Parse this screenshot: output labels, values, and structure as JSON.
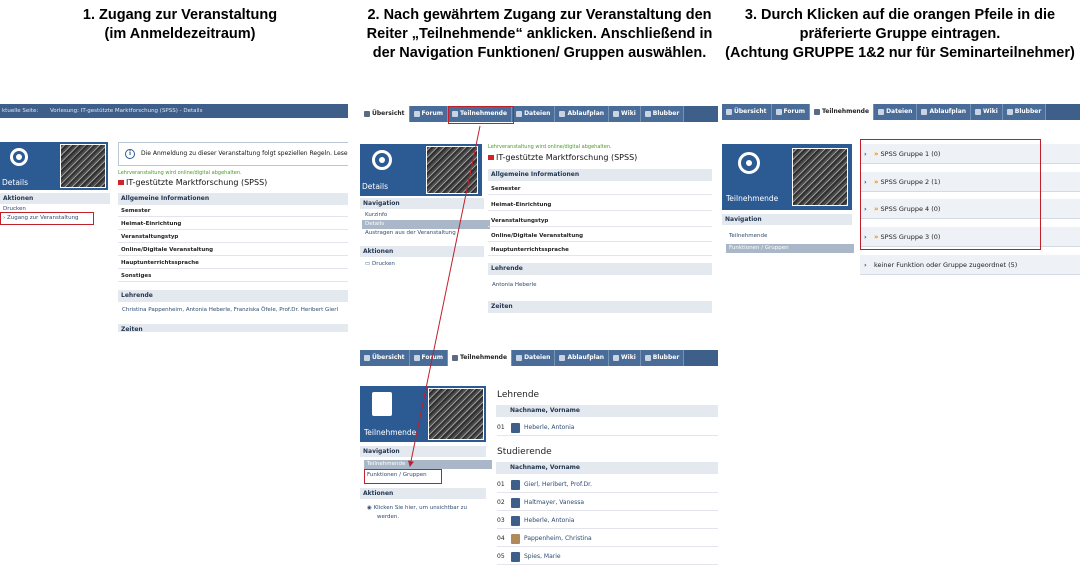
{
  "headings": {
    "step1": [
      "1.     Zugang zur Veranstaltung",
      "(im Anmeldezeitraum)"
    ],
    "step2": [
      "2. Nach gewährtem Zugang zur Veranstaltung den",
      "Reiter „Teilnehmende“ anklicken. Anschließend in",
      "der Navigation Funktionen/ Gruppen auswählen."
    ],
    "step3": [
      "3. Durch Klicken auf die orangen Pfeile in die",
      "präferierte Gruppe eintragen.",
      "(Achtung GRUPPE 1&2 nur für Seminarteilnehmer)"
    ]
  },
  "panel1": {
    "breadcrumb": [
      "ktuelle Seite:",
      "Vorlesung: IT-gestützte Marktforschung (SPSS) - Details"
    ],
    "hero_title": "Details",
    "notice": "Die Anmeldung zu dieser Veranstaltung folgt speziellen Regeln. Lese",
    "online_note": "Lehrveranstaltung wird online/digital abgehalten.",
    "course_title": "IT-gestützte Marktforschung (SPSS)",
    "actions_head": "Aktionen",
    "actions": [
      "Drucken",
      "Zugang zur Veranstaltung"
    ],
    "general_head": "Allgemeine Informationen",
    "general_rows": [
      "Semester",
      "Heimat-Einrichtung",
      "Veranstaltungstyp",
      "Online/Digitale Veranstaltung",
      "Hauptunterrichtssprache",
      "Sonstiges"
    ],
    "lecturers_head": "Lehrende",
    "lecturers": "Christina Pappenheim,  Antonia Heberle,  Franziska Öfele,  Prof.Dr. Heribert Gierl",
    "times_head": "Zeiten"
  },
  "panel2": {
    "tabs": [
      "Übersicht",
      "Forum",
      "Teilnehmende",
      "Dateien",
      "Ablaufplan",
      "Wiki",
      "Blubber"
    ],
    "active_tab": "Übersicht",
    "hero_title": "Details",
    "nav_head": "Navigation",
    "nav_items": [
      "Kurzinfo",
      "Details",
      "Austragen aus der Veranstaltung"
    ],
    "actions_head": "Aktionen",
    "actions": [
      "Drucken"
    ],
    "online_note": "Lehrveranstaltung wird online/digital abgehalten.",
    "course_title": "IT-gestützte Marktforschung (SPSS)",
    "general_head": "Allgemeine Informationen",
    "general_rows": [
      "Semester",
      "Heimat-Einrichtung",
      "Veranstaltungstyp",
      "Online/Digitale Veranstaltung",
      "Hauptunterrichtssprache"
    ],
    "lecturers_head": "Lehrende",
    "lecturers": "Antonia Heberle",
    "times_head": "Zeiten"
  },
  "panel3": {
    "tabs": [
      "Übersicht",
      "Forum",
      "Teilnehmende",
      "Dateien",
      "Ablaufplan",
      "Wiki",
      "Blubber"
    ],
    "active_tab": "Teilnehmende",
    "hero_title": "Teilnehmende",
    "nav_head": "Navigation",
    "nav_items": [
      "Teilnehmende",
      "Funktionen / Gruppen"
    ],
    "actions_head": "Aktionen",
    "actions": [
      "Klicken Sie hier, um unsichtbar zu",
      "werden."
    ],
    "lecturers_head": "Lehrende",
    "col_label": "Nachname, Vorname",
    "lecturers": [
      {
        "num": "01",
        "name": "Heberle, Antonia"
      }
    ],
    "students_head": "Studierende",
    "students": [
      {
        "num": "01",
        "name": "Gierl, Heribert, Prof.Dr."
      },
      {
        "num": "02",
        "name": "Haltmayer, Vanessa"
      },
      {
        "num": "03",
        "name": "Heberle, Antonia"
      },
      {
        "num": "04",
        "name": "Pappenheim, Christina"
      },
      {
        "num": "05",
        "name": "Spies, Marie"
      }
    ]
  },
  "panel4": {
    "tabs": [
      "Übersicht",
      "Forum",
      "Teilnehmende",
      "Dateien",
      "Ablaufplan",
      "Wiki",
      "Blubber"
    ],
    "active_tab": "Teilnehmende",
    "hero_title": "Teilnehmende",
    "nav_head": "Navigation",
    "nav_items": [
      "Teilnehmende",
      "Funktionen / Gruppen"
    ],
    "groups": [
      "SPSS Gruppe 1 (0)",
      "SPSS Gruppe 2 (1)",
      "SPSS Gruppe 4 (0)",
      "SPSS Gruppe 3 (0)"
    ],
    "no_group": "keiner Funktion oder Gruppe zugeordnet (5)",
    "group_arrow_glyph": "»",
    "chevron_glyph": "›"
  },
  "colors": {
    "brand_blue": "#3e5f8a",
    "highlight_red": "#c0202a",
    "orange_arrows": "#f29100",
    "online_green": "#4a9a2a"
  }
}
